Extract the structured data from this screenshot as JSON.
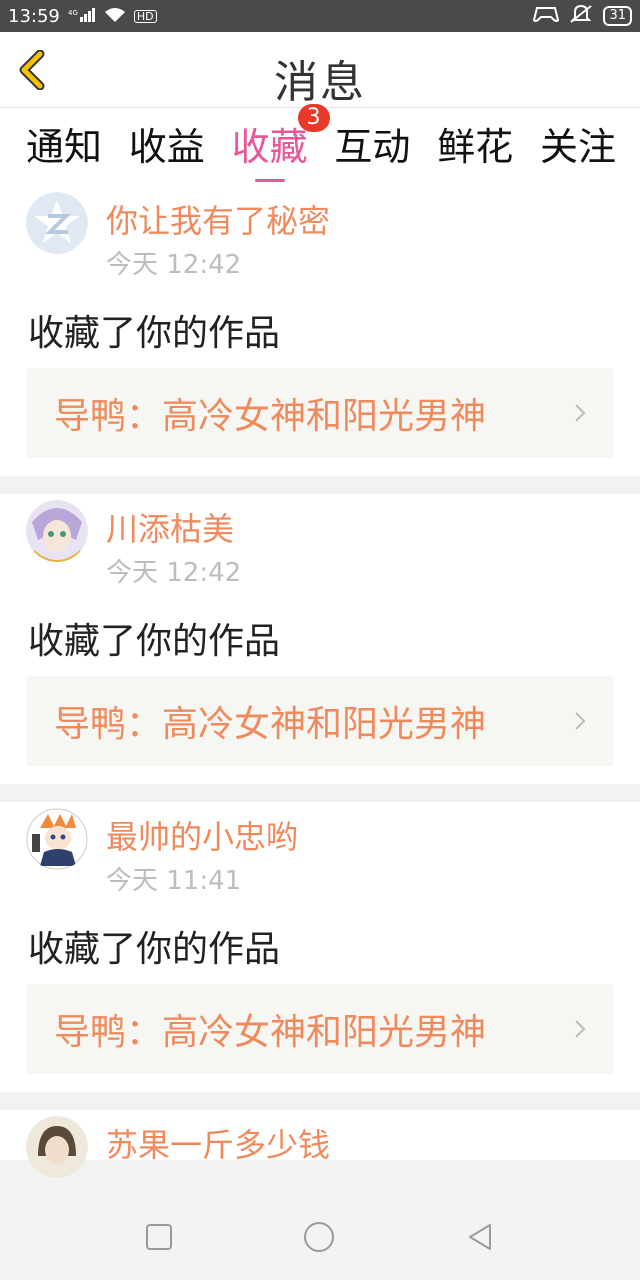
{
  "status_bar": {
    "time": "13:59",
    "signal_label": "4G",
    "hd_label": "HD",
    "battery": "31",
    "icons": [
      "signal-icon",
      "wifi-icon",
      "hd-icon",
      "gamepad-icon",
      "mute-bell-icon",
      "battery-icon"
    ]
  },
  "header": {
    "title": "消息",
    "back_icon": "back-chevron-icon"
  },
  "tabs": [
    {
      "label": "通知"
    },
    {
      "label": "收益"
    },
    {
      "label": "收藏",
      "active": true,
      "badge": "3"
    },
    {
      "label": "互动"
    },
    {
      "label": "鲜花"
    },
    {
      "label": "关注"
    }
  ],
  "messages": [
    {
      "username": "你让我有了秘密",
      "time": "今天 12:42",
      "action": "收藏了你的作品",
      "work": "导鸭：高冷女神和阳光男神"
    },
    {
      "username": "川添枯美",
      "time": "今天 12:42",
      "action": "收藏了你的作品",
      "work": "导鸭：高冷女神和阳光男神"
    },
    {
      "username": "最帅的小忠哟",
      "time": "今天 11:41",
      "action": "收藏了你的作品",
      "work": "导鸭：高冷女神和阳光男神"
    },
    {
      "username": "苏果一斤多少钱"
    }
  ],
  "nav_bar": {
    "icons": [
      "recent-apps-icon",
      "home-icon",
      "back-icon"
    ]
  },
  "colors": {
    "accent_pink": "#e9579a",
    "orange_text": "#f08a5d",
    "badge_red": "#e8392b",
    "back_yellow": "#f2c200"
  }
}
